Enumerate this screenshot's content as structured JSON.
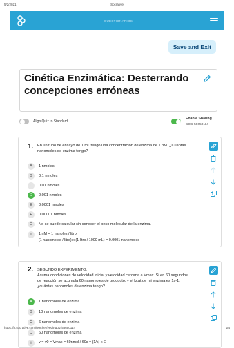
{
  "print": {
    "date": "5/2/2021",
    "site_title": "Socrative",
    "url": "https://b.socrative.com/teacher/#edit-quiz/58650114",
    "page": "1/4"
  },
  "navbar": {
    "title": "CUESTIONARIOS",
    "logo_icon": "socrative-logo-icon",
    "menu_icon": "hamburger-menu-icon",
    "background": "#29a3d4"
  },
  "save_button": "Save and Exit",
  "quiz": {
    "title": "Cinética Enzimática: Desterrando concepciones erróneas",
    "align_label": "Align Quiz to Standard",
    "align_enabled": false,
    "sharing_label": "Enable Sharing",
    "sharing_enabled": true,
    "share_code": "SOC-58650114"
  },
  "questions": [
    {
      "number": "1.",
      "text": "En un tubo de ensayo de 1 mL tengo una concentración de enzima de 1 nM. ¿Cuántas nanomoles de enzima tengo?",
      "options": [
        {
          "letter": "A",
          "text": "1 nmoles",
          "correct": false
        },
        {
          "letter": "B",
          "text": "0.1 nmoles",
          "correct": false
        },
        {
          "letter": "C",
          "text": "0.01 nmoles",
          "correct": false
        },
        {
          "letter": "D",
          "text": "0.001 nmoles",
          "correct": true
        },
        {
          "letter": "E",
          "text": "0.0001 nmoles",
          "correct": false
        },
        {
          "letter": "F",
          "text": "0.00001 nmoles",
          "correct": false
        },
        {
          "letter": "G",
          "text": "No se puede calcular sin conocer el peso molecular de la enzima.",
          "correct": false
        }
      ],
      "explanation_icon": "i",
      "explanation": [
        "1 nM = 1 nanoles / litro",
        "(1 nanomoles / litro) x (1 litro / 1000 mL) = 0.0001 nanomoles"
      ]
    },
    {
      "number": "2.",
      "text_lines": [
        "SEGUNDO EXPERIMENTO:",
        "Asuma condiciones de velocidad inicial y velocidad cercana a Vmax. Si en 60 segundos de reacción se acumula 60 nanomoles de producto, y el kcat de mi enzima es 1s-1, ¿cuántas nanomoles de enzima tengo?"
      ],
      "options": [
        {
          "letter": "A",
          "text": "1 nanomoles de enzima",
          "correct": true
        },
        {
          "letter": "B",
          "text": "10 nanomoles de enzima",
          "correct": false
        },
        {
          "letter": "C",
          "text": "6 nanomoles de enzima",
          "correct": false
        },
        {
          "letter": "D",
          "text": "60 nanomoles de enzima",
          "correct": false
        }
      ],
      "explanation_icon": "i",
      "explanation": [
        "v = v0 = Vmax = 60nmol / 60s = (1/s) x E"
      ]
    }
  ],
  "colors": {
    "accent": "#29a3d4",
    "correct": "#4cb84c",
    "save_bg": "#d6effb"
  }
}
